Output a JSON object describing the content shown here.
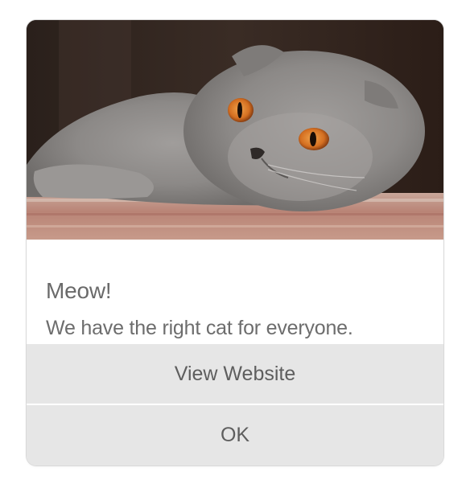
{
  "dialog": {
    "image": "cat-photo",
    "title": "Meow!",
    "message": "We have the right cat for everyone.",
    "buttons": {
      "view_website": "View Website",
      "ok": "OK"
    }
  },
  "colors": {
    "button_background": "#e6e6e6",
    "text": "#6a6a6a",
    "cat_fur": "#8a8886",
    "cat_eyes": "#d9772a"
  }
}
